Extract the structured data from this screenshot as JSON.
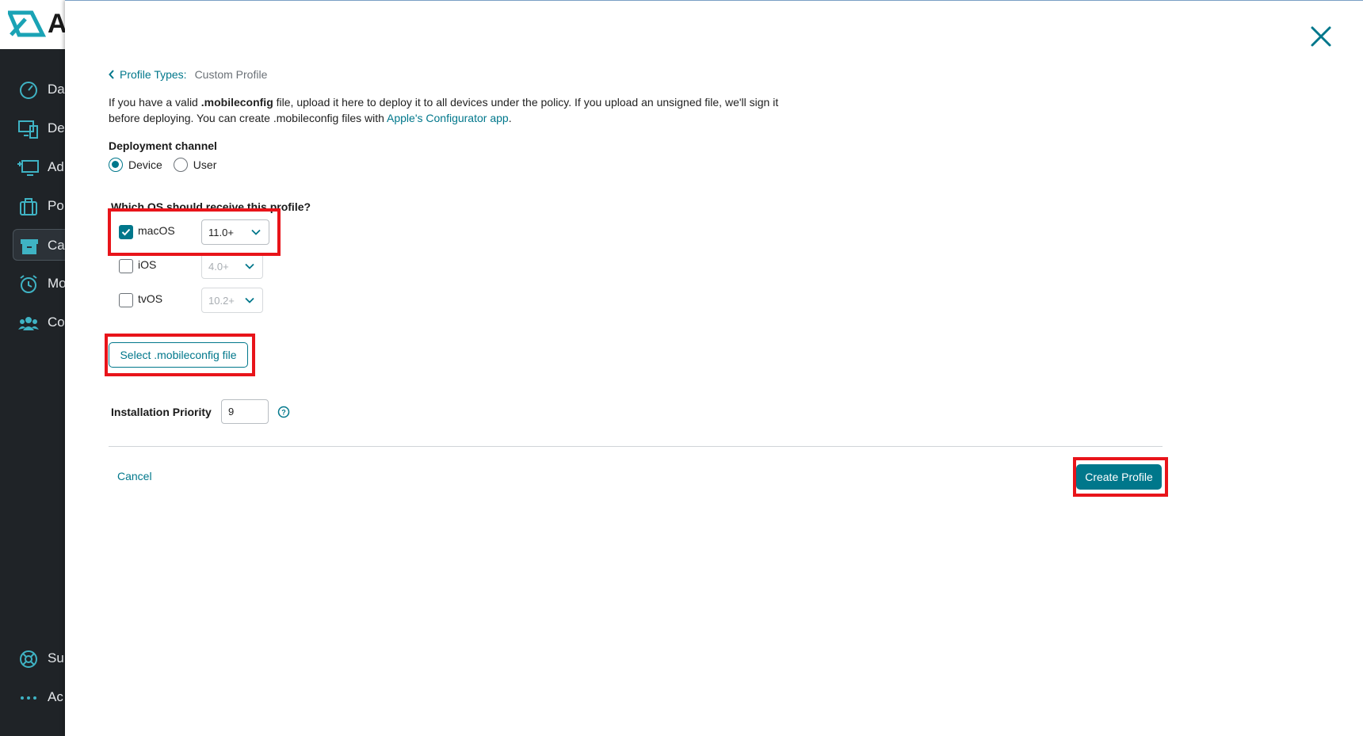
{
  "app": {
    "logo_letter": "A",
    "nav": [
      {
        "label": "Da",
        "icon": "gauge-icon"
      },
      {
        "label": "De",
        "icon": "devices-icon"
      },
      {
        "label": "Ad",
        "icon": "add-device-icon"
      },
      {
        "label": "Po",
        "icon": "briefcase-icon"
      },
      {
        "label": "Ca",
        "icon": "archive-icon"
      },
      {
        "label": "Mo",
        "icon": "alarm-clock-icon"
      },
      {
        "label": "Co",
        "icon": "users-icon"
      },
      {
        "label": "Su",
        "icon": "lifebuoy-icon"
      },
      {
        "label": "Ac",
        "icon": "more-dots-icon"
      }
    ]
  },
  "breadcrumb": {
    "back_label": "Profile Types:",
    "current": "Custom Profile"
  },
  "description": {
    "part1": "If you have a valid ",
    "bold": ".mobileconfig",
    "part2": " file, upload it here to deploy it to all devices under the policy. If you upload an unsigned file, we'll sign it before deploying. You can create .mobileconfig files with ",
    "link": "Apple's Configurator app",
    "part3": "."
  },
  "deployment": {
    "label": "Deployment channel",
    "options": [
      {
        "label": "Device",
        "checked": true
      },
      {
        "label": "User",
        "checked": false
      }
    ]
  },
  "os": {
    "label": "Which OS should receive this profile?",
    "items": [
      {
        "label": "macOS",
        "checked": true,
        "version": "11.0+"
      },
      {
        "label": "iOS",
        "checked": false,
        "version": "4.0+"
      },
      {
        "label": "tvOS",
        "checked": false,
        "version": "10.2+"
      }
    ]
  },
  "file_button": "Select .mobileconfig file",
  "priority": {
    "label": "Installation Priority",
    "value": "9"
  },
  "footer": {
    "cancel": "Cancel",
    "create": "Create Profile"
  },
  "colors": {
    "accent": "#00778b",
    "highlight": "#e8141a",
    "sidebar": "#1f2327"
  }
}
